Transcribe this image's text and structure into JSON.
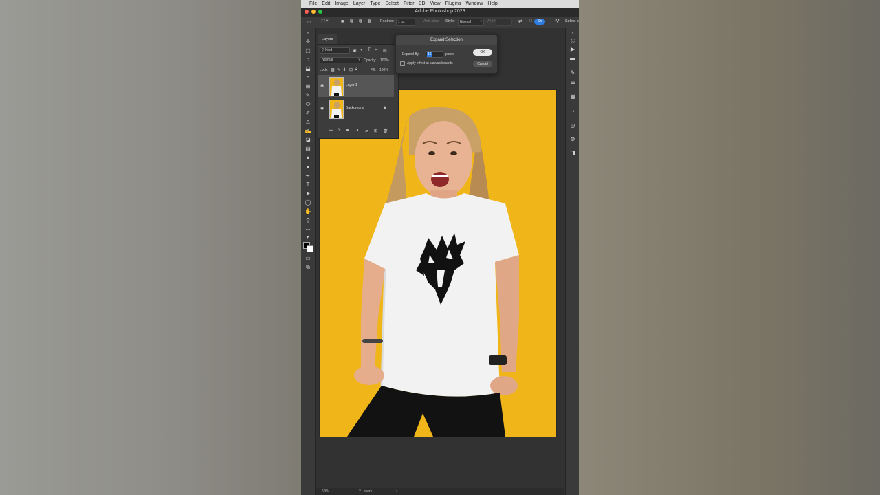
{
  "menubar": {
    "items": [
      "File",
      "Edit",
      "Image",
      "Layer",
      "Type",
      "Select",
      "Filter",
      "3D",
      "View",
      "Plugins",
      "Window",
      "Help"
    ]
  },
  "titlebar": {
    "title": "Adobe Photoshop 2023"
  },
  "options": {
    "feather_label": "Feather:",
    "feather_value": "1 px",
    "antialias_label": "Anti-alias",
    "style_label": "Style:",
    "style_value": "Normal",
    "width_label": "Width:",
    "select_subject_label": "Select s",
    "pill_label": "Sh"
  },
  "layers_panel": {
    "tab": "Layers",
    "filter_kind": "Kind",
    "blend_mode": "Normal",
    "opacity_label": "Opacity:",
    "opacity_value": "100%",
    "lock_label": "Lock:",
    "fill_label": "Fill:",
    "fill_value": "100%",
    "layers": [
      {
        "name": "Layer 1",
        "selected": true,
        "visible": true
      },
      {
        "name": "Background",
        "selected": false,
        "visible": true,
        "locked": true
      }
    ]
  },
  "dialog": {
    "title": "Expand Selection",
    "expand_by_label": "Expand By:",
    "expand_by_value": "16",
    "unit": "pixels",
    "checkbox_label": "Apply effect at canvas bounds",
    "checkbox_checked": false,
    "ok_label": "OK",
    "cancel_label": "Cancel"
  },
  "status": {
    "zoom": "60%",
    "layers_count": "2 Layers"
  },
  "colors": {
    "accent": "#2f7de1",
    "background_yellow": "#f0b518",
    "ui_dark": "#323232"
  }
}
